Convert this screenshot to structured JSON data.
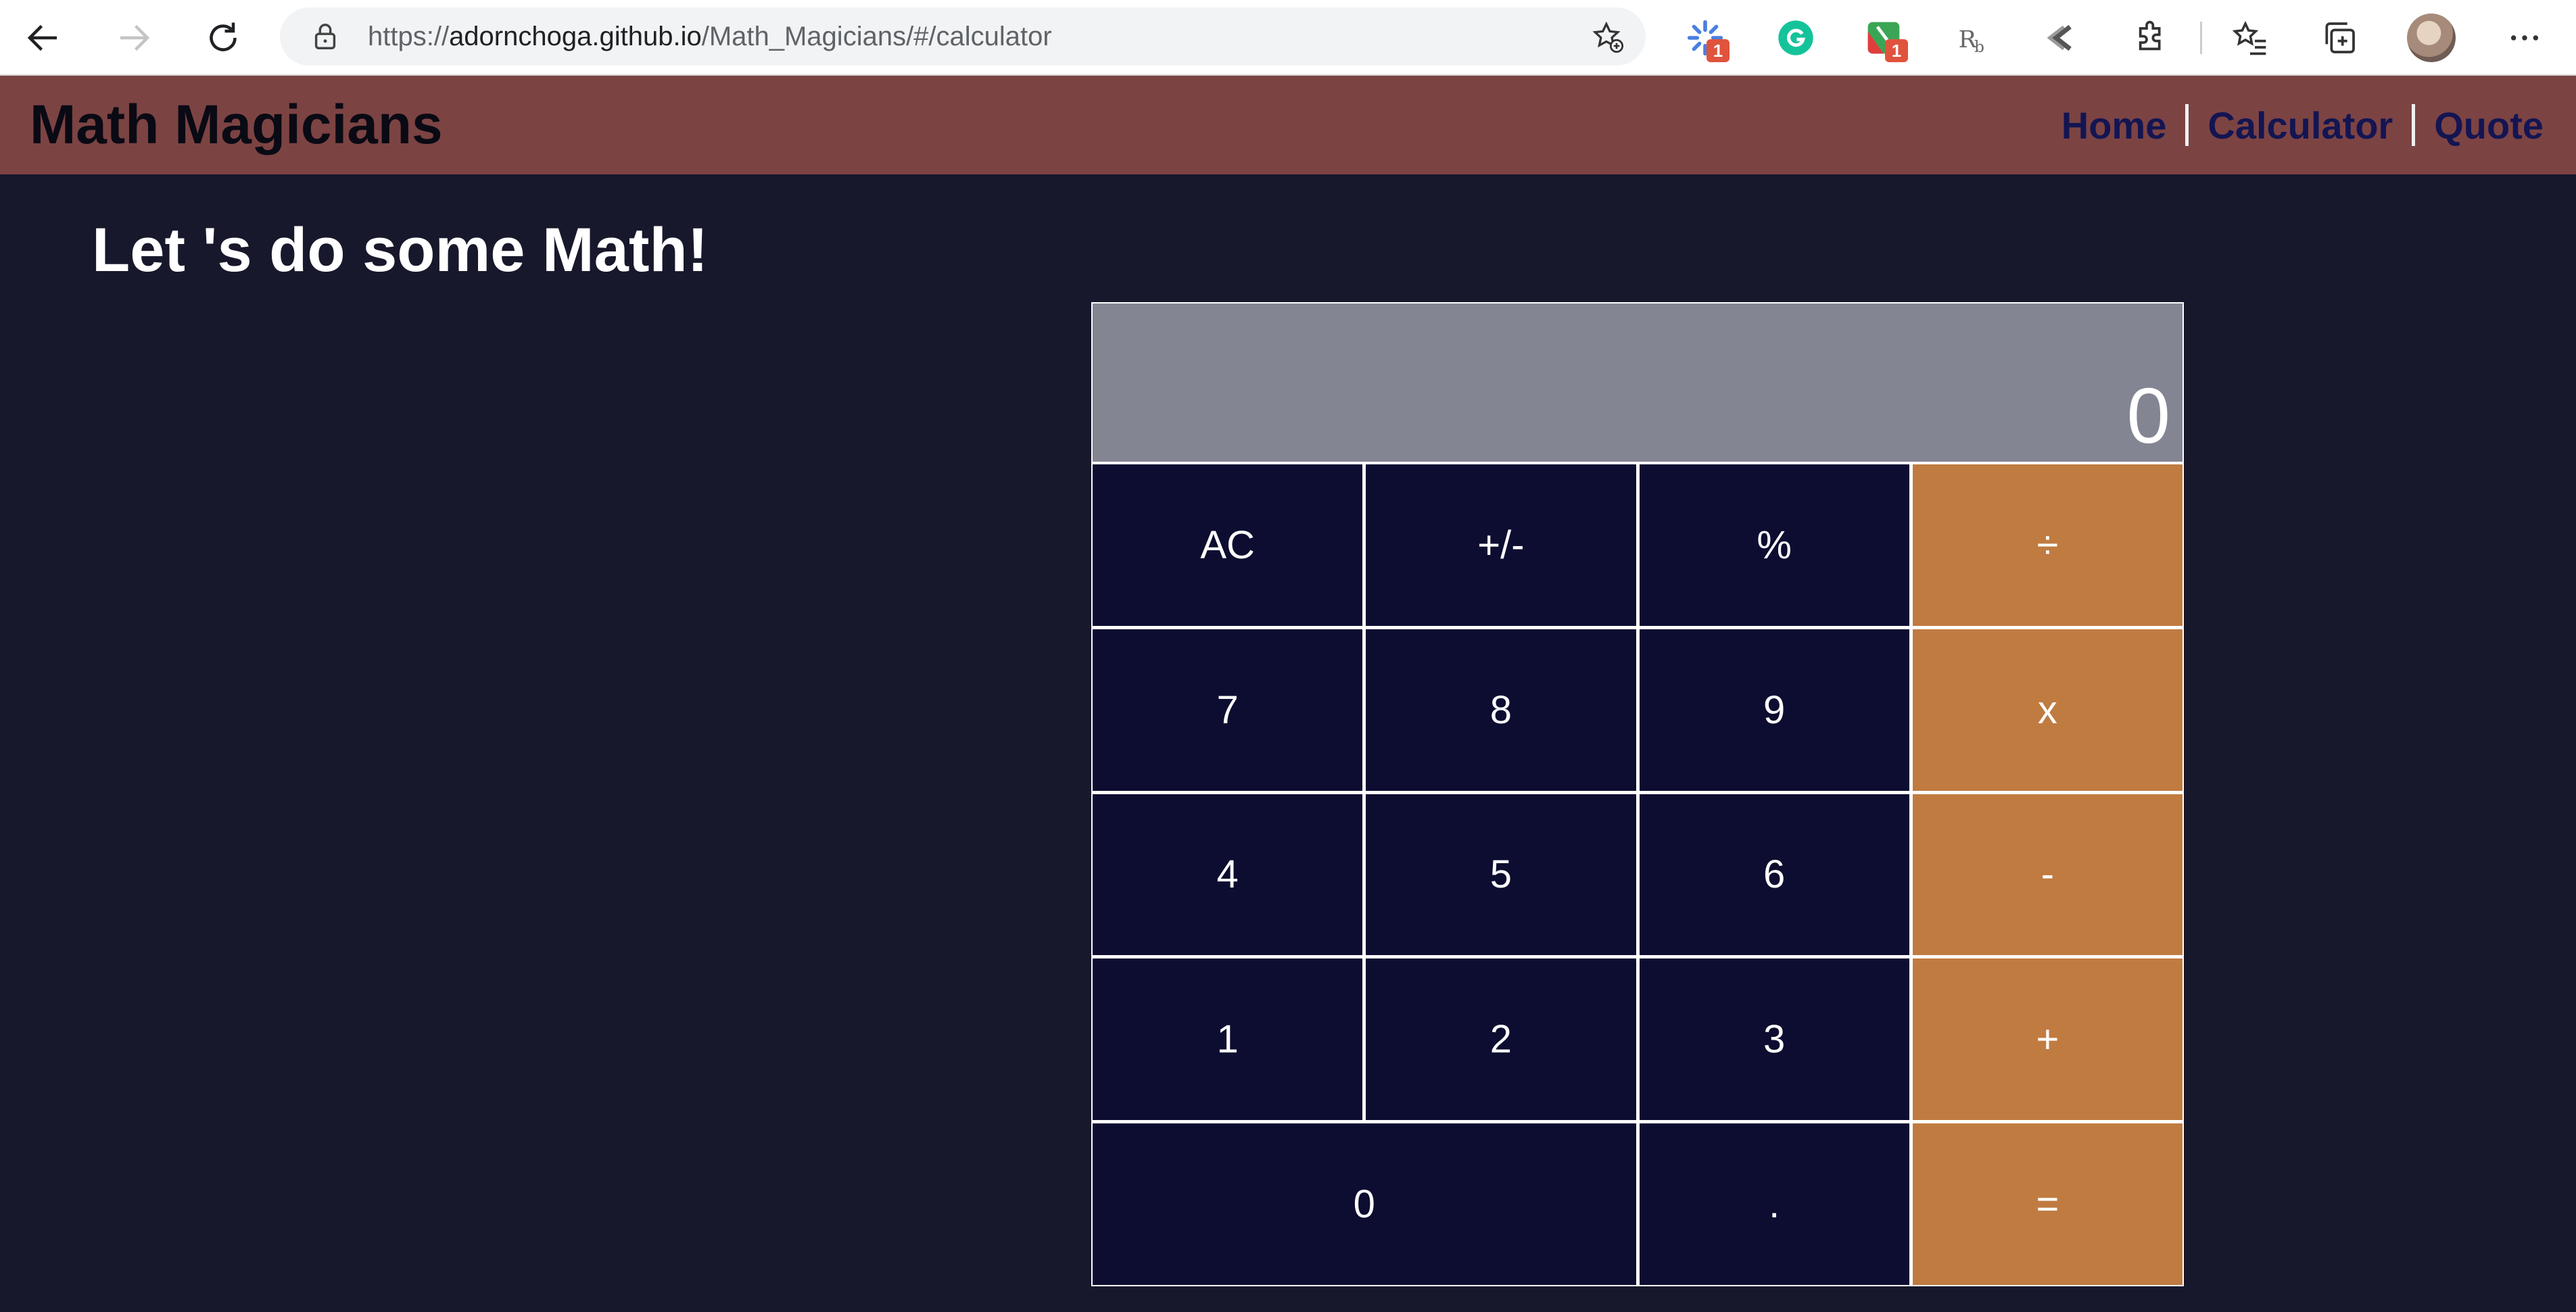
{
  "browser": {
    "url_prefix": "https://",
    "url_host": "adornchoga.github.io",
    "url_path": "/Math_Magicians/#/calculator",
    "extensions": [
      {
        "icon": "loading-spinner-extension-icon",
        "badge": "1"
      },
      {
        "icon": "grammarly-icon",
        "badge": ""
      },
      {
        "icon": "colorful-extension-icon",
        "badge": "1"
      },
      {
        "icon": "reader-extension-icon",
        "badge": ""
      },
      {
        "icon": "arrow-extension-icon",
        "badge": ""
      }
    ]
  },
  "header": {
    "brand": "Math Magicians",
    "nav": [
      "Home",
      "Calculator",
      "Quote"
    ]
  },
  "main": {
    "heading": "Let 's do some Math!"
  },
  "calculator": {
    "display": "0",
    "keys": [
      "AC",
      "+/-",
      "%",
      "÷",
      "7",
      "8",
      "9",
      "x",
      "4",
      "5",
      "6",
      "-",
      "1",
      "2",
      "3",
      "+",
      "0",
      ".",
      "="
    ]
  },
  "colors": {
    "header_bg": "#7c4343",
    "page_bg": "#17182b",
    "display_bg": "#838593",
    "key_bg": "#0d0d31",
    "operator_bg": "#c07b41",
    "nav_link": "#131552"
  }
}
